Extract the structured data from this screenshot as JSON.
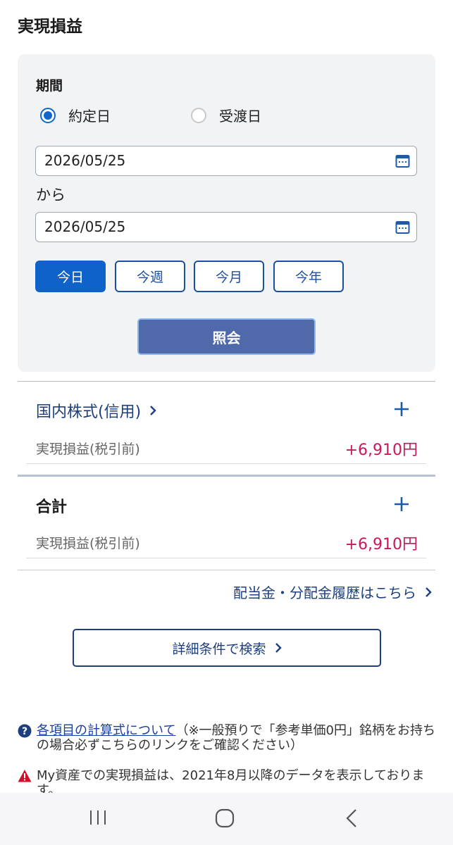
{
  "page": {
    "title": "実現損益"
  },
  "filter": {
    "period_label": "期間",
    "radio_options": [
      {
        "label": "約定日",
        "selected": true
      },
      {
        "label": "受渡日",
        "selected": false
      }
    ],
    "date_from": "2026/05/25",
    "from_to_label": "から",
    "date_to": "2026/05/25",
    "presets": [
      {
        "label": "今日",
        "active": true
      },
      {
        "label": "今週",
        "active": false
      },
      {
        "label": "今月",
        "active": false
      },
      {
        "label": "今年",
        "active": false
      }
    ],
    "submit_label": "照会"
  },
  "sections": [
    {
      "title": "国内株式(信用)",
      "pl_label": "実現損益(税引前)",
      "pl_value": "+6,910円"
    },
    {
      "title": "合計",
      "pl_label": "実現損益(税引前)",
      "pl_value": "+6,910円"
    }
  ],
  "links": {
    "history": "配当金・分配金履歴はこちら",
    "detail_search": "詳細条件で検索"
  },
  "notes": {
    "formula_link": "各項目の計算式について",
    "formula_text": "（※一般預りで「参考単価0円」銘柄をお持ちの場合必ずこちらのリンクをご確認ください）",
    "warning_text": "My資産での実現損益は、2021年8月以降のデータを表示しております。"
  },
  "icons": {
    "calendar": "calendar-icon",
    "plus": "plus-icon",
    "chevron": "chevron-right-icon",
    "help": "question-circle-icon",
    "warning": "warning-triangle-icon"
  },
  "colors": {
    "primary": "#0f62c9",
    "navy": "#1d3f80",
    "profit": "#c8175d",
    "submit": "#4f69aa"
  }
}
